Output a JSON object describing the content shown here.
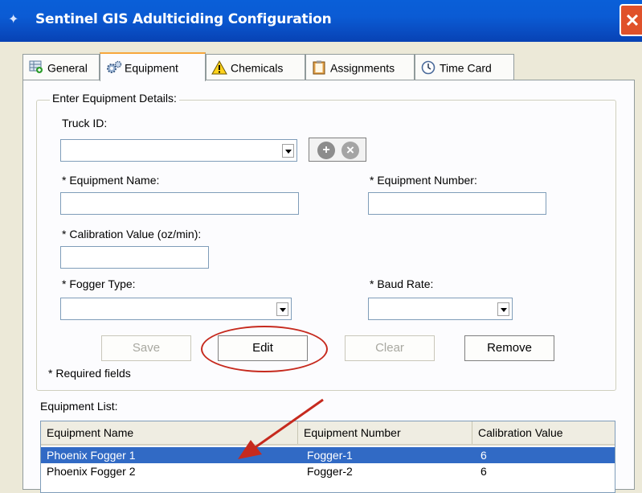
{
  "window": {
    "title": "Sentinel GIS Adulticiding Configuration",
    "close_glyph": "✕"
  },
  "tabs": [
    {
      "label": "General",
      "icon": "grid-plus-icon"
    },
    {
      "label": "Equipment",
      "icon": "gears-icon"
    },
    {
      "label": "Chemicals",
      "icon": "warning-icon"
    },
    {
      "label": "Assignments",
      "icon": "clipboard-icon"
    },
    {
      "label": "Time Card",
      "icon": "clock-icon"
    }
  ],
  "active_tab": "Equipment",
  "details": {
    "group_label": "Enter Equipment Details:",
    "truck_id_label": "Truck ID:",
    "truck_id_value": "",
    "equipment_name_label": "* Equipment Name:",
    "equipment_name_value": "",
    "equipment_number_label": "* Equipment Number:",
    "equipment_number_value": "",
    "calibration_label": "* Calibration Value (oz/min):",
    "calibration_value": "",
    "fogger_type_label": "* Fogger Type:",
    "fogger_type_value": "",
    "baud_rate_label": "* Baud Rate:",
    "baud_rate_value": "",
    "add_glyph": "+",
    "remove_glyph": "×",
    "required_note": "* Required fields"
  },
  "buttons": {
    "save": "Save",
    "edit": "Edit",
    "clear": "Clear",
    "remove": "Remove"
  },
  "list": {
    "label": "Equipment List:",
    "columns": [
      "Equipment Name",
      "Equipment Number",
      "Calibration Value"
    ],
    "rows": [
      {
        "name": "Phoenix Fogger 1",
        "number": "Fogger-1",
        "calibration": "6"
      },
      {
        "name": "Phoenix Fogger 2",
        "number": "Fogger-2",
        "calibration": "6"
      }
    ],
    "selected_row": "Phoenix Fogger 1"
  },
  "colors": {
    "titlebar": "#0a5fd8",
    "selection": "#316ac5",
    "annotation": "#c62a1e",
    "active_tab_accent": "#f7a73c"
  }
}
